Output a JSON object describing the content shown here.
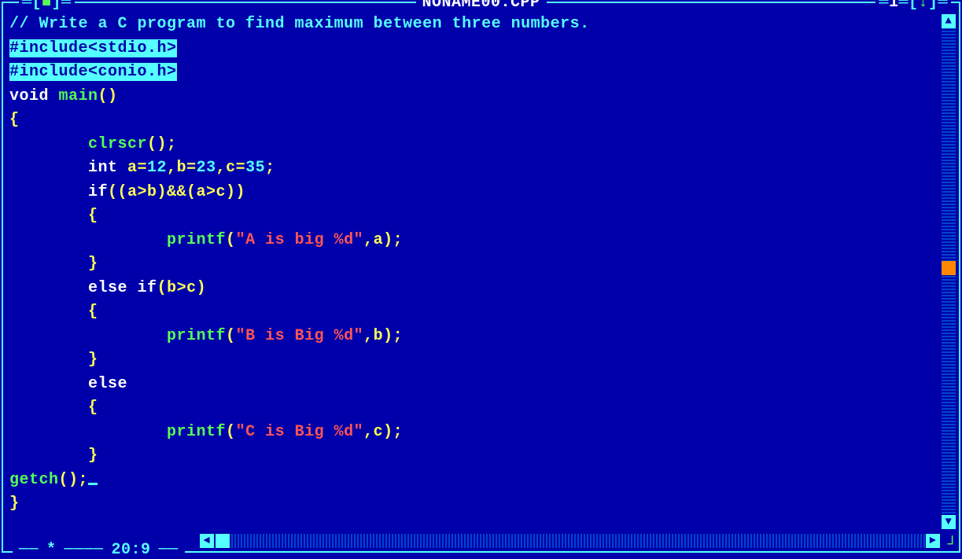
{
  "title": {
    "filename": "NONAME00.CPP",
    "window_num": "1",
    "close_glyph": "■",
    "zoom_glyph": "↕"
  },
  "status": {
    "modified_glyph": "*",
    "cursor_pos": "20:9"
  },
  "scroll": {
    "up_glyph": "▲",
    "down_glyph": "▼",
    "left_glyph": "◄",
    "right_glyph": "►"
  },
  "code": {
    "l1_comment": "// Write a C program to find maximum between three numbers.",
    "l2_inc1": "#include<stdio.h>",
    "l3_inc2": "#include<conio.h>",
    "l4_void": "void",
    "l4_main": " main",
    "l4_par": "()",
    "l5_brace": "{",
    "l6_indent": "        ",
    "l6_clr": "clrscr",
    "l6_punc": "();",
    "l7_indent": "        ",
    "l7_int": "int",
    "l7_rest1": " a=",
    "l7_n1": "12",
    "l7_rest2": ",b=",
    "l7_n2": "23",
    "l7_rest3": ",c=",
    "l7_n3": "35",
    "l7_semi": ";",
    "l8_indent": "        ",
    "l8_if": "if",
    "l8_cond": "((a>b)&&(a>c))",
    "l9_brace": "        {",
    "l10_indent": "                ",
    "l10_pf": "printf",
    "l10_open": "(",
    "l10_str": "\"A is big %d\"",
    "l10_close": ",a);",
    "l11_brace": "        }",
    "l12_indent": "        ",
    "l12_else": "else",
    "l12_sp": " ",
    "l12_if": "if",
    "l12_cond": "(b>c)",
    "l13_brace": "        {",
    "l14_indent": "                ",
    "l14_pf": "printf",
    "l14_open": "(",
    "l14_str": "\"B is Big %d\"",
    "l14_close": ",b);",
    "l15_brace": "        }",
    "l16_indent": "        ",
    "l16_else": "else",
    "l17_brace": "        {",
    "l18_indent": "                ",
    "l18_pf": "printf",
    "l18_open": "(",
    "l18_str": "\"C is Big %d\"",
    "l18_close": ",c);",
    "l19_brace": "        }",
    "l20_getch": "getch",
    "l20_punc": "();",
    "l21_brace": "}"
  }
}
